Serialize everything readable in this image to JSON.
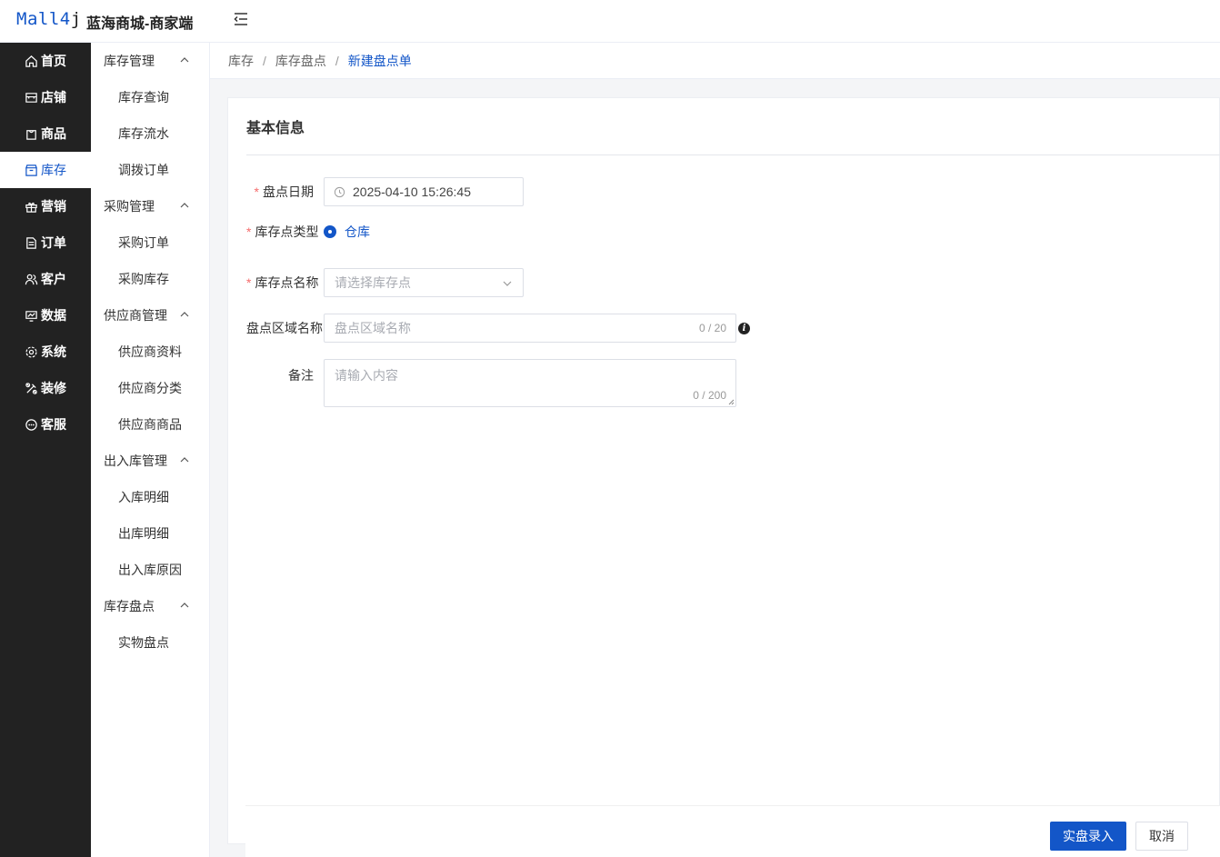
{
  "header": {
    "logo_main": "Mall4",
    "logo_j": "j",
    "title": "蓝海商城-商家端",
    "collapse_icon": "menu-fold-icon"
  },
  "sidebar": {
    "items": [
      {
        "label": "首页",
        "icon": "home-icon"
      },
      {
        "label": "店铺",
        "icon": "shop-icon"
      },
      {
        "label": "商品",
        "icon": "goods-icon"
      },
      {
        "label": "库存",
        "icon": "inventory-icon"
      },
      {
        "label": "营销",
        "icon": "gift-icon"
      },
      {
        "label": "订单",
        "icon": "order-icon"
      },
      {
        "label": "客户",
        "icon": "customer-icon"
      },
      {
        "label": "数据",
        "icon": "data-icon"
      },
      {
        "label": "系统",
        "icon": "gear-icon"
      },
      {
        "label": "装修",
        "icon": "decorate-icon"
      },
      {
        "label": "客服",
        "icon": "chat-icon"
      }
    ],
    "active_index": 3
  },
  "submenu": {
    "groups": [
      {
        "label": "库存管理",
        "items": [
          "库存查询",
          "库存流水",
          "调拨订单"
        ]
      },
      {
        "label": "采购管理",
        "items": [
          "采购订单",
          "采购库存"
        ]
      },
      {
        "label": "供应商管理",
        "items": [
          "供应商资料",
          "供应商分类",
          "供应商商品"
        ]
      },
      {
        "label": "出入库管理",
        "items": [
          "入库明细",
          "出库明细",
          "出入库原因"
        ]
      },
      {
        "label": "库存盘点",
        "items": [
          "实物盘点"
        ]
      }
    ]
  },
  "breadcrumb": {
    "items": [
      "库存",
      "库存盘点"
    ],
    "current": "新建盘点单",
    "separator": "/"
  },
  "card": {
    "title": "基本信息"
  },
  "form": {
    "required_mark": "*",
    "date": {
      "label": "盘点日期",
      "value": "2025-04-10 15:26:45"
    },
    "point_type": {
      "label": "库存点类型",
      "option": "仓库"
    },
    "point_name": {
      "label": "库存点名称",
      "placeholder": "请选择库存点"
    },
    "area_name": {
      "label": "盘点区域名称",
      "placeholder": "盘点区域名称",
      "counter": "0 / 20",
      "info_icon": "i"
    },
    "remark": {
      "label": "备注",
      "placeholder": "请输入内容",
      "counter": "0 / 200"
    }
  },
  "footer": {
    "submit_label": "实盘录入",
    "cancel_label": "取消"
  },
  "colors": {
    "primary": "#1356c8",
    "sidebar_bg": "#222222",
    "required": "#f56c6c"
  }
}
